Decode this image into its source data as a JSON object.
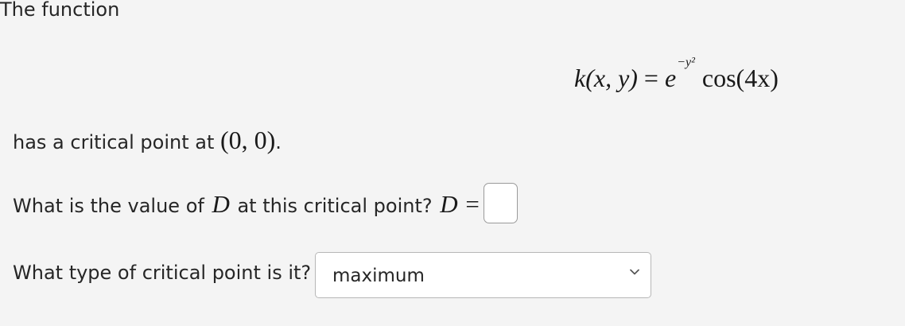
{
  "problem": {
    "intro": "The function",
    "formula": {
      "lhs": "k(x, y)",
      "equals": " = ",
      "base": "e",
      "exponent": "−y²",
      "rhs": " cos(4x)"
    },
    "critical_prefix": "has a critical point at ",
    "critical_point": "(0, 0)",
    "critical_suffix": "."
  },
  "question_d": {
    "prefix": "What is the value of ",
    "variable": "D",
    "middle": " at this critical point? ",
    "lhs": "D",
    "equals": " = ",
    "answer": ""
  },
  "question_type": {
    "label": "What type of critical point is it?",
    "selected": "maximum",
    "chevron_icon": "chevron-down-icon"
  }
}
